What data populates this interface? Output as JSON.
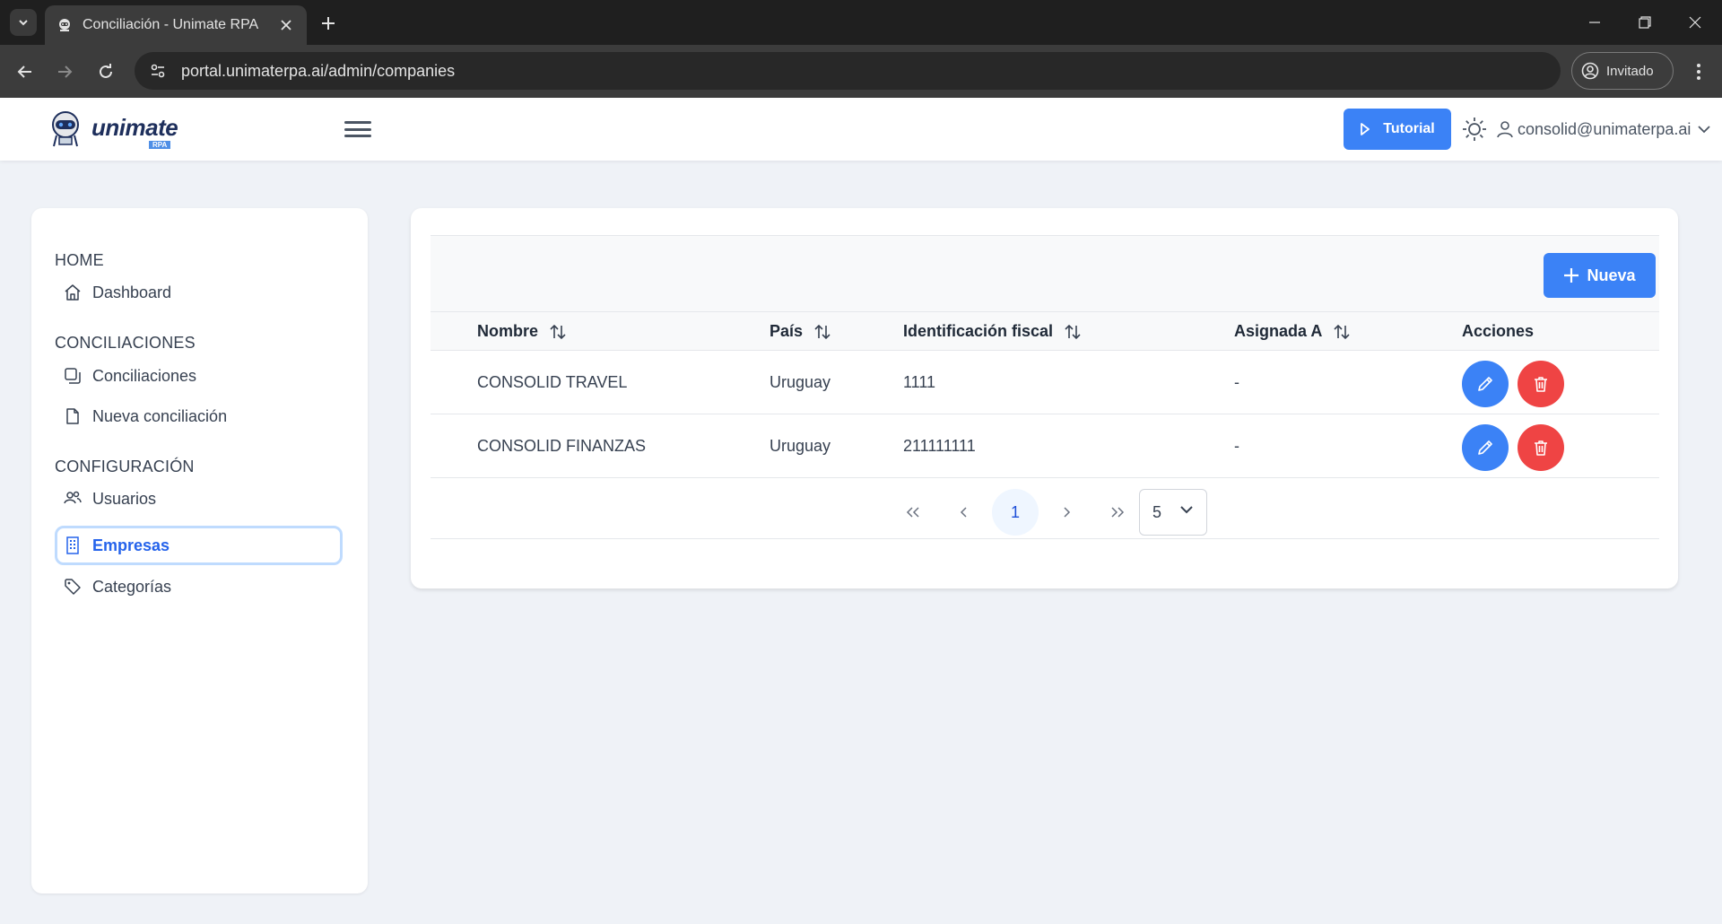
{
  "browser": {
    "tab_title": "Conciliación - Unimate RPA",
    "url": "portal.unimaterpa.ai/admin/companies",
    "profile_label": "Invitado"
  },
  "header": {
    "logo_text": "unimate",
    "logo_sub": "RPA",
    "tutorial_label": "Tutorial",
    "user_email": "consolid@unimaterpa.ai"
  },
  "sidebar": {
    "sections": [
      {
        "title": "HOME",
        "items": [
          {
            "label": "Dashboard",
            "icon": "home-icon"
          }
        ]
      },
      {
        "title": "CONCILIACIONES",
        "items": [
          {
            "label": "Conciliaciones",
            "icon": "copy-icon"
          },
          {
            "label": "Nueva conciliación",
            "icon": "file-icon"
          }
        ]
      },
      {
        "title": "CONFIGURACIÓN",
        "items": [
          {
            "label": "Usuarios",
            "icon": "users-icon"
          },
          {
            "label": "Empresas",
            "icon": "building-icon",
            "active": true
          },
          {
            "label": "Categorías",
            "icon": "tag-icon"
          }
        ]
      }
    ]
  },
  "main": {
    "new_button_label": "Nueva",
    "columns": [
      "Nombre",
      "País",
      "Identificación fiscal",
      "Asignada A",
      "Acciones"
    ],
    "rows": [
      {
        "nombre": "CONSOLID TRAVEL",
        "pais": "Uruguay",
        "id_fiscal": "1111",
        "asignada": "-"
      },
      {
        "nombre": "CONSOLID FINANZAS",
        "pais": "Uruguay",
        "id_fiscal": "211111111",
        "asignada": "-"
      }
    ],
    "pagination": {
      "current_page": "1",
      "rows_per_page": "5"
    }
  },
  "colors": {
    "primary": "#3b82f6",
    "danger": "#ef4444",
    "active_text": "#2563eb"
  }
}
